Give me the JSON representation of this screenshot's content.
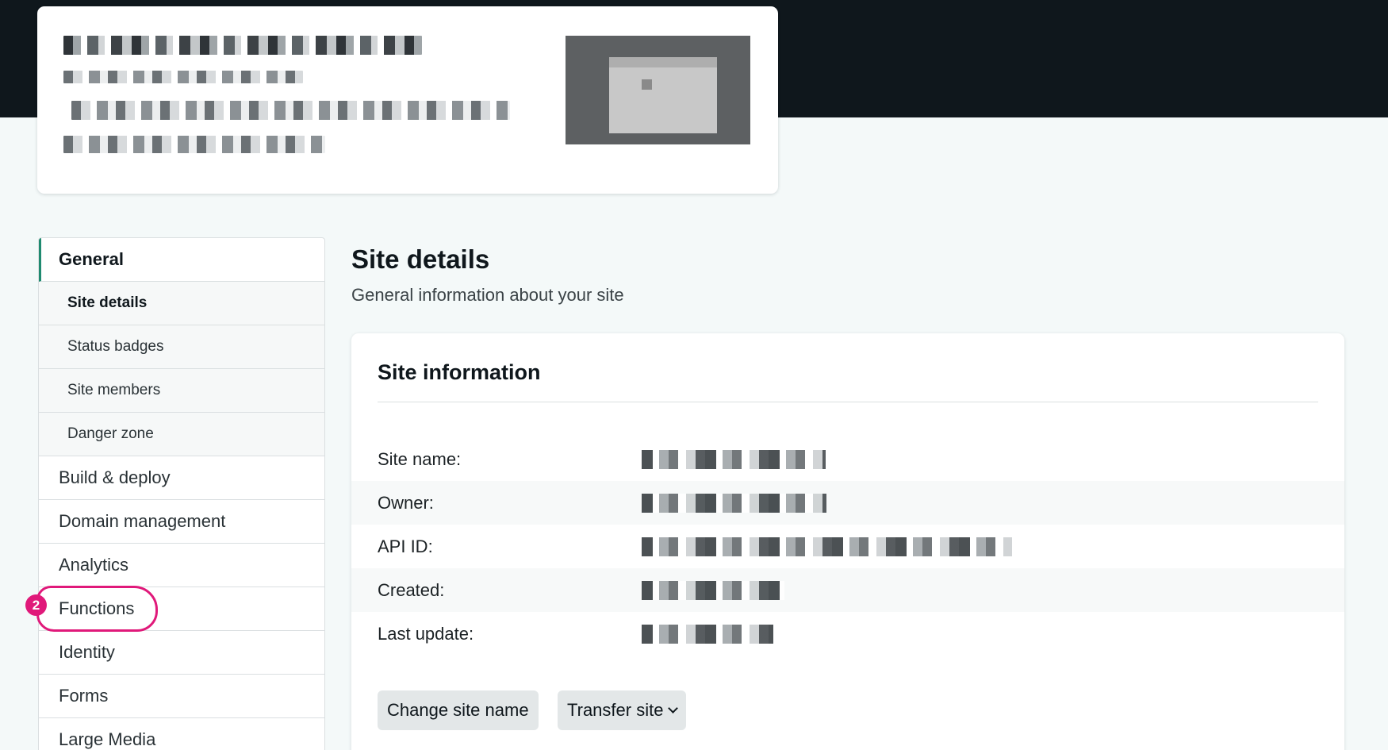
{
  "colors": {
    "topbar": "#0f171c",
    "accent": "#1f8a70",
    "annotation": "#e0197a",
    "background": "#f4f9f9"
  },
  "annotation": {
    "badge": "2"
  },
  "sidebar": {
    "items": [
      {
        "label": "General",
        "active": true
      },
      {
        "label": "Site details",
        "sub": true,
        "current": true
      },
      {
        "label": "Status badges",
        "sub": true
      },
      {
        "label": "Site members",
        "sub": true
      },
      {
        "label": "Danger zone",
        "sub": true
      },
      {
        "label": "Build & deploy"
      },
      {
        "label": "Domain management"
      },
      {
        "label": "Analytics"
      },
      {
        "label": "Functions",
        "highlighted": true
      },
      {
        "label": "Identity"
      },
      {
        "label": "Forms"
      },
      {
        "label": "Large Media"
      }
    ]
  },
  "main": {
    "title": "Site details",
    "subtitle": "General information about your site"
  },
  "site_info": {
    "title": "Site information",
    "rows": [
      {
        "label": "Site name:"
      },
      {
        "label": "Owner:"
      },
      {
        "label": "API ID:"
      },
      {
        "label": "Created:"
      },
      {
        "label": "Last update:"
      }
    ],
    "change_name_label": "Change site name",
    "transfer_label": "Transfer site",
    "transfer_icon": "chevron-down-icon"
  }
}
